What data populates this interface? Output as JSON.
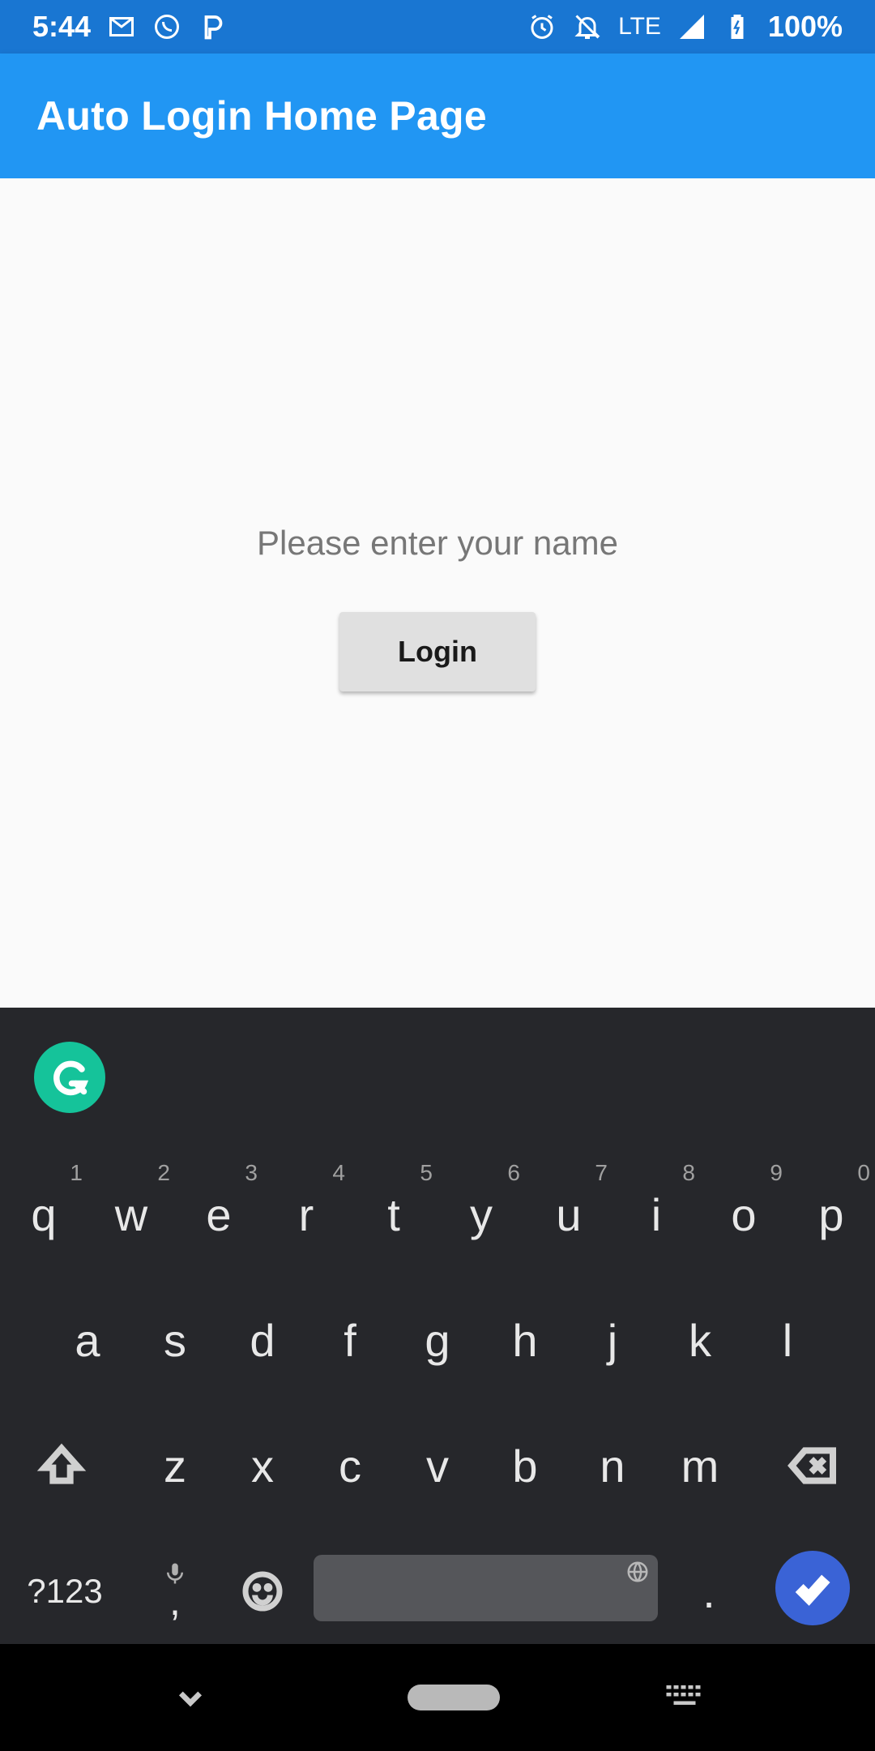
{
  "status_bar": {
    "time": "5:44",
    "network": "LTE",
    "battery": "100%",
    "icons": [
      "gmail-icon",
      "whatsapp-icon",
      "paypal-icon",
      "alarm-icon",
      "notifications-off-icon",
      "signal-icon",
      "battery-icon"
    ],
    "background": "#1976d2"
  },
  "app_bar": {
    "title": "Auto Login Home Page",
    "background": "#2196f3"
  },
  "form": {
    "name_placeholder": "Please enter your name",
    "name_value": "",
    "login_label": "Login"
  },
  "keyboard": {
    "grammarly_icon": "grammarly-icon",
    "row1": [
      {
        "key": "q",
        "hint": "1"
      },
      {
        "key": "w",
        "hint": "2"
      },
      {
        "key": "e",
        "hint": "3"
      },
      {
        "key": "r",
        "hint": "4"
      },
      {
        "key": "t",
        "hint": "5"
      },
      {
        "key": "y",
        "hint": "6"
      },
      {
        "key": "u",
        "hint": "7"
      },
      {
        "key": "i",
        "hint": "8"
      },
      {
        "key": "o",
        "hint": "9"
      },
      {
        "key": "p",
        "hint": "0"
      }
    ],
    "row2": [
      "a",
      "s",
      "d",
      "f",
      "g",
      "h",
      "j",
      "k",
      "l"
    ],
    "row3": [
      "z",
      "x",
      "c",
      "v",
      "b",
      "n",
      "m"
    ],
    "symbols_label": "?123",
    "comma_label": ",",
    "period_label": ".",
    "accent_color": "#3a63d6"
  },
  "nav_bar": {
    "icons": [
      "chevron-down-icon",
      "home-pill",
      "keyboard-icon"
    ]
  }
}
